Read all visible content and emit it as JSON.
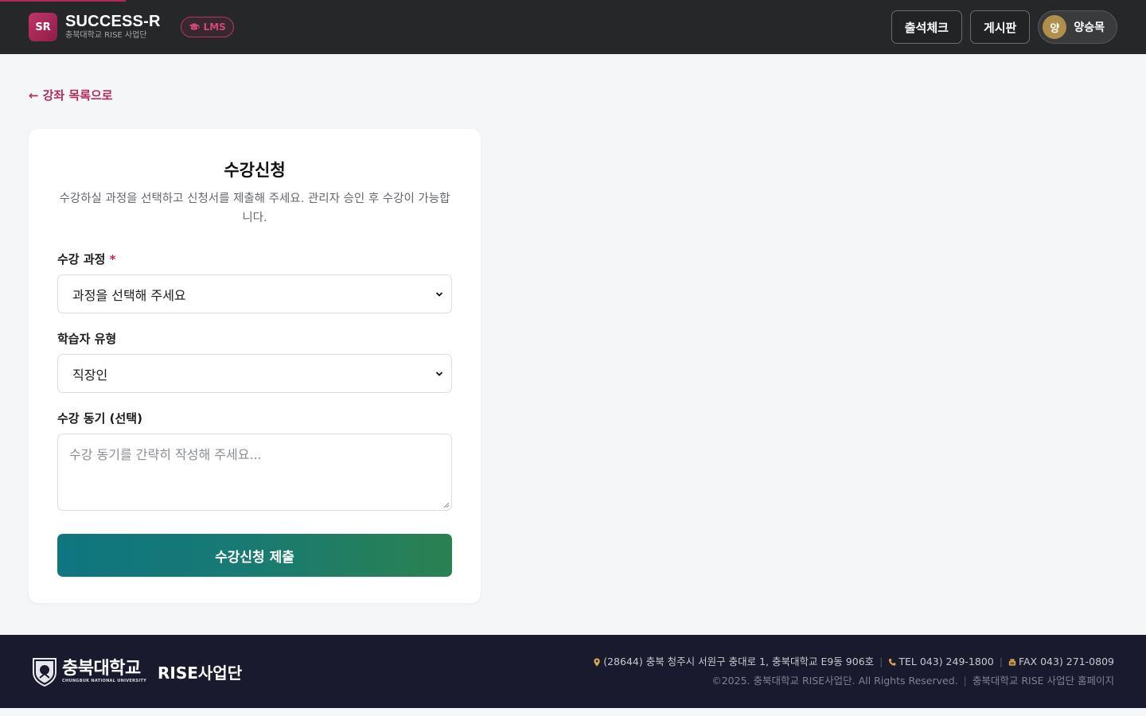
{
  "header": {
    "brand_badge": "SR",
    "brand_title": "SUCCESS-R",
    "brand_subtitle": "충북대학교 RISE 사업단",
    "lms_label": "LMS",
    "nav": {
      "attendance": "출석체크",
      "board": "게시판"
    },
    "user": {
      "avatar_initial": "양",
      "name": "양승목"
    }
  },
  "back_link": {
    "arrow": "←",
    "label": "강좌 목록으로"
  },
  "form": {
    "title": "수강신청",
    "description": "수강하실 과정을 선택하고 신청서를 제출해 주세요. 관리자 승인 후 수강이 가능합니다.",
    "course": {
      "label": "수강 과정",
      "required_mark": "*",
      "selected": "과정을 선택해 주세요"
    },
    "learner_type": {
      "label": "학습자 유형",
      "selected": "직장인"
    },
    "motivation": {
      "label": "수강 동기 (선택)",
      "placeholder": "수강 동기를 간략히 작성해 주세요..."
    },
    "submit_label": "수강신청 제출"
  },
  "footer": {
    "university_ko": "충북대학교",
    "university_en": "CHUNGBUK NATIONAL UNIVERSITY",
    "rise_label": "RISE사업단",
    "address": "(28644) 충북 청주시 서원구 충대로 1, 충북대학교 E9동 906호",
    "tel": "TEL 043) 249-1800",
    "fax": "FAX 043) 271-0809",
    "copyright": "©2025. 충북대학교 RISE사업단. All Rights Reserved.",
    "homepage_link": "충북대학교 RISE 사업단 홈페이지"
  },
  "colors": {
    "header_bg": "#262728",
    "accent": "#b22d5e",
    "submit_gradient_start": "#0f7580",
    "submit_gradient_end": "#2a8150",
    "footer_bg": "#1a1a2e",
    "avatar_bg": "#b08f4a"
  }
}
